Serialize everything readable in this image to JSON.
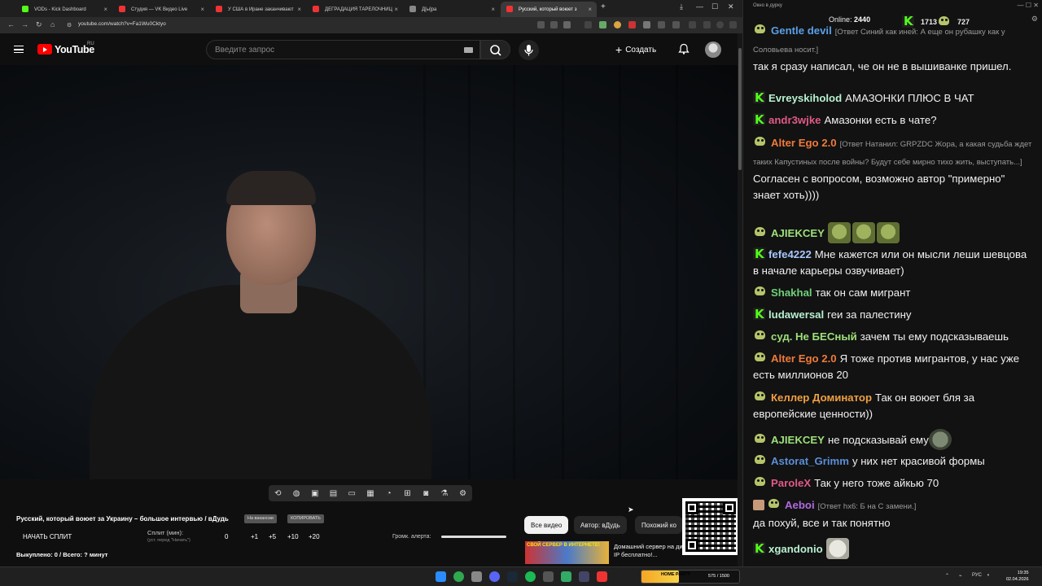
{
  "browser": {
    "tabs": [
      {
        "title": "VODs - Kick Dashboard",
        "color": "#53fc18"
      },
      {
        "title": "Студия — VK Видео Live",
        "color": "#e33"
      },
      {
        "title": "У США в Иране заканчивают",
        "color": "#e33"
      },
      {
        "title": "ДЕГРАДАЦИЯ ТАРЕЛОЧНИЦ",
        "color": "#e33"
      },
      {
        "title": "Д[ы]ра",
        "color": "#888"
      },
      {
        "title": "Русский, который воюет з",
        "color": "#e33"
      }
    ],
    "new_tab": "+",
    "url": "youtube.com/watch?v=Fa1Wu0Cktyo"
  },
  "youtube": {
    "logo_text": "YouTube",
    "region": "RU",
    "search_placeholder": "Введите запрос",
    "create_label": "Создать"
  },
  "tools": {
    "title": "Русский, который воюет за Украину – большое интервью / вДудь",
    "pill1": "На вакансии",
    "pill2": "КОПИРОВАТЬ",
    "split_button": "НАЧАТЬ СПЛИТ",
    "split_label": "Сплит (мин):",
    "split_hint": "(уст. перед \"Начать\")",
    "split_values": [
      "0",
      "+1",
      "+5",
      "+10",
      "+20"
    ],
    "volume_label": "Громк. алерта:",
    "bought": "Выкуплено: 0 / Всего: ? минут"
  },
  "chips": [
    "Все видео",
    "Автор: вДудь",
    "Похожий ко"
  ],
  "recommendation": {
    "thumb_text": "СВОЙ СЕРВЕР В ИНТЕРНЕТЕ!",
    "title": "Домашний сервер на динамическом IP бесплатно!..."
  },
  "chat": {
    "window_title": "Окно в дурку",
    "online_label": "Online:",
    "online_count": "2440",
    "kick_count": "1713",
    "frog_count": "727",
    "messages": [
      {
        "badge": "frog",
        "user": "Gentle devil",
        "color": "#5aa0e6",
        "reply": "[Ответ Синий как иней: А еще он рубашку как у Соловьева носит.]",
        "text": "так я сразу написал, че он не в вышиванке пришел."
      },
      {
        "badge": "kick",
        "user": "Evreyskiholod",
        "color": "#b8f0d0",
        "text": "АМАЗОНКИ ПЛЮС В ЧАТ"
      },
      {
        "badge": "kick",
        "user": "andr3wjke",
        "color": "#e05a87",
        "text": "Амазонки есть в чате?"
      },
      {
        "badge": "frog",
        "user": "Alter Ego 2.0",
        "color": "#f07a3a",
        "reply": "[Ответ Натанил: GRPZDC Жора, а какая судьба ждет таких Капустиных после войны? Будут себе мирно тихо жить, выступать...]",
        "text": "Согласен с вопросом, возможно автор \"примерно\" знает хоть))))"
      },
      {
        "badge": "frog",
        "user": "AJIEKCEY",
        "color": "#9ee07a",
        "text": ""
      },
      {
        "badge": "kick",
        "user": "fefe4222",
        "color": "#a7c7ff",
        "text": "Мне кажется или он мысли леши шевцова в начале карьеры озвучивает)"
      },
      {
        "badge": "frog",
        "user": "Shakhal",
        "color": "#6fd07a",
        "text": "так он сам мигрант"
      },
      {
        "badge": "kick",
        "user": "ludawersal",
        "color": "#b8f0d0",
        "text": "геи за палестину"
      },
      {
        "badge": "frog",
        "user": "суд. Не БЕСный",
        "color": "#9ee07a",
        "text": "зачем ты ему подсказываешь"
      },
      {
        "badge": "frog",
        "user": "Alter Ego 2.0",
        "color": "#f07a3a",
        "text": "Я тоже против мигрантов, у нас уже есть миллионов 20"
      },
      {
        "badge": "frog",
        "user": "Келлер Доминатор",
        "color": "#f0a040",
        "text": "Так он воюет бля за европейские ценности))"
      },
      {
        "badge": "frog",
        "user": "AJIEKCEY",
        "color": "#9ee07a",
        "text": "не подсказывай ему"
      },
      {
        "badge": "frog",
        "user": "Astorat_Grimm",
        "color": "#5a8fd8",
        "text": "у них нет красивой формы"
      },
      {
        "badge": "frog",
        "user": "ParoleX",
        "color": "#e05a87",
        "text": "Так у него тоже айкью 70"
      },
      {
        "badge": "giftfrog",
        "user": "Aeboi",
        "color": "#b06ae0",
        "reply": "[Ответ hx6: Б на С замени.]",
        "text": "да похуй, все и так понятно"
      },
      {
        "badge": "kick",
        "user": "xgandonio",
        "color": "#b8f0d0",
        "text": ""
      }
    ]
  },
  "taskbar": {
    "stream_logo": "HOME PARTY",
    "stream_count": "575 / 1500",
    "stream_progress": 0.38,
    "lang": "РУС",
    "time": "19:35",
    "date": "02.04.2026"
  }
}
